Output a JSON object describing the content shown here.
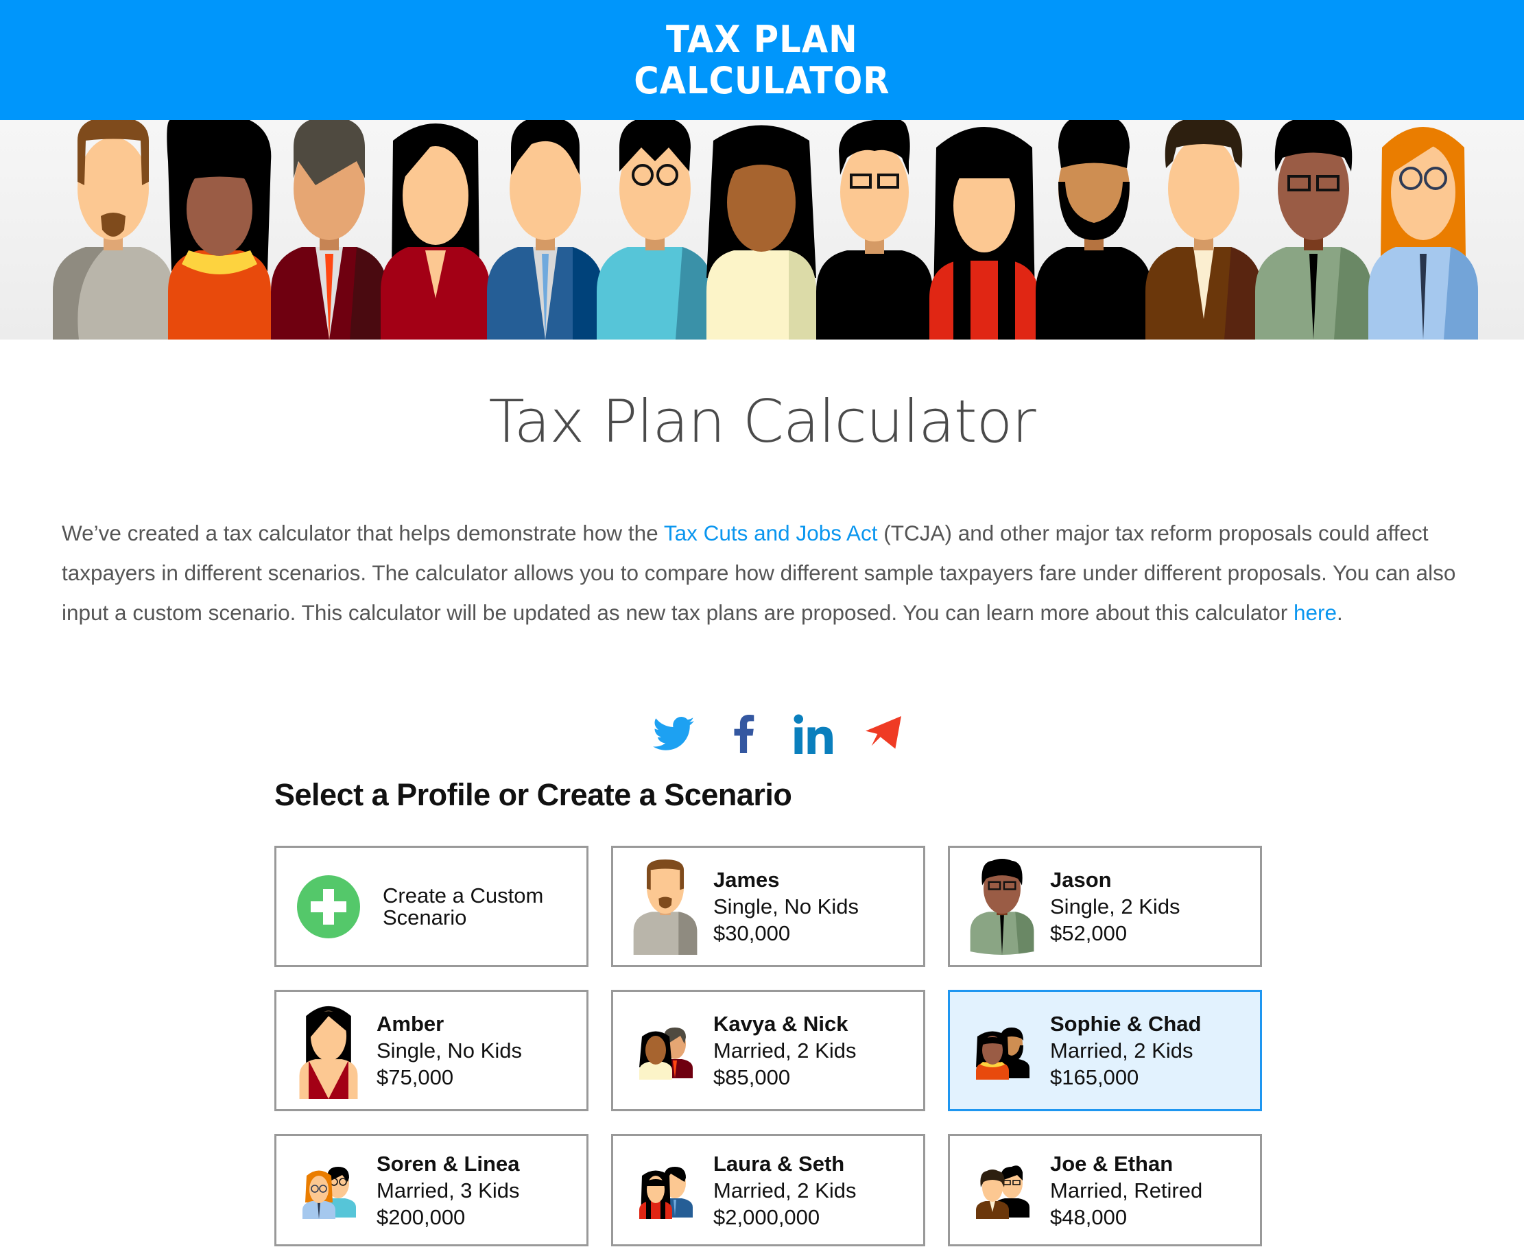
{
  "header": {
    "logo_line1": "TAX PLAN",
    "logo_line2": "CALCULATOR",
    "background_color": "#0096fb"
  },
  "banner": {
    "description": "Illustrated row of thirteen diverse taxpayer avatars"
  },
  "page_title": "Tax Plan Calculator",
  "intro": {
    "text_before_link": "We’ve created a tax calculator that helps demonstrate how the ",
    "link1_label": "Tax Cuts and Jobs Act",
    "text_after_link": " (TCJA) and other major tax reform proposals could affect taxpayers in different scenarios. The calculator allows you to compare how different sample taxpayers fare under different proposals. You can also input a custom scenario. This calculator will be updated as new tax plans are proposed. You can learn more about this calculator ",
    "link2_label": "here",
    "text_end": ".",
    "link_color": "#0a96ef"
  },
  "social": [
    {
      "name": "twitter",
      "icon": "twitter-icon",
      "color": "#1da1f2"
    },
    {
      "name": "facebook",
      "icon": "facebook-icon",
      "color": "#3b5998"
    },
    {
      "name": "linkedin",
      "icon": "linkedin-icon",
      "color": "#0077b5"
    },
    {
      "name": "share",
      "icon": "paper-plane-icon",
      "color": "#ef3b24"
    }
  ],
  "section_heading": "Select a Profile or Create a Scenario",
  "profiles": [
    {
      "id": "custom",
      "label_line1": "Create a Custom",
      "label_line2": "Scenario",
      "icon": "plus-circle-icon",
      "selected": false
    },
    {
      "id": "james",
      "name": "James",
      "status": "Single, No Kids",
      "income": "$30,000",
      "selected": false
    },
    {
      "id": "jason",
      "name": "Jason",
      "status": "Single, 2 Kids",
      "income": "$52,000",
      "selected": false
    },
    {
      "id": "amber",
      "name": "Amber",
      "status": "Single, No Kids",
      "income": "$75,000",
      "selected": false
    },
    {
      "id": "kavya-nick",
      "name": "Kavya & Nick",
      "status": "Married, 2 Kids",
      "income": "$85,000",
      "selected": false
    },
    {
      "id": "sophie-chad",
      "name": "Sophie & Chad",
      "status": "Married, 2 Kids",
      "income": "$165,000",
      "selected": true
    },
    {
      "id": "soren-linea",
      "name": "Soren & Linea",
      "status": "Married, 3 Kids",
      "income": "$200,000",
      "selected": false
    },
    {
      "id": "laura-seth",
      "name": "Laura & Seth",
      "status": "Married, 2 Kids",
      "income": "$2,000,000",
      "selected": false
    },
    {
      "id": "joe-ethan",
      "name": "Joe & Ethan",
      "status": "Married, Retired",
      "income": "$48,000",
      "selected": false
    }
  ],
  "colors": {
    "selected_border": "#1e96f0",
    "selected_background": "#e2f2fe",
    "card_border": "#999999",
    "create_icon_green": "#54c86a"
  }
}
